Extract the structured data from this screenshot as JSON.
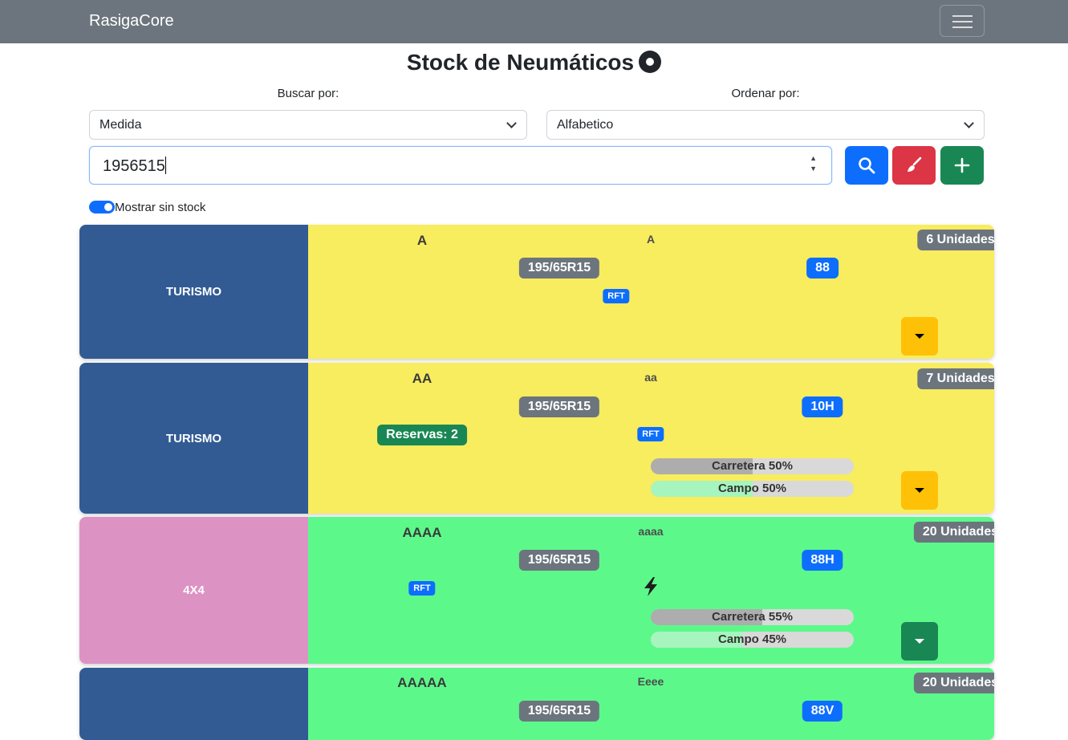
{
  "navbar": {
    "brand": "RasigaCore"
  },
  "page": {
    "title": "Stock de Neumáticos"
  },
  "filters": {
    "search_by_label": "Buscar por:",
    "search_by_value": "Medida",
    "order_by_label": "Ordenar por:",
    "order_by_value": "Alfabetico",
    "query_value": "1956515",
    "show_no_stock_label": "Mostrar sin stock",
    "show_no_stock": true
  },
  "colors": {
    "navbar": "#6c757d",
    "search_button": "#0d6efd",
    "clear_button": "#dc3545",
    "add_button": "#198754",
    "yellow_card": "#f8ec5f",
    "green_card": "#5cf98a",
    "turismo": "#325b94",
    "4x4": "#dd92c4"
  },
  "cards": [
    {
      "category": "TURISMO",
      "brand": "A",
      "model": "A",
      "units": "6 Unidades",
      "size": "195/65R15",
      "load": "88",
      "rft": "RFT"
    },
    {
      "category": "TURISMO",
      "brand": "AA",
      "model": "aa",
      "units": "7 Unidades",
      "size": "195/65R15",
      "load": "10H",
      "reservations": "Reservas: 2",
      "rft": "RFT",
      "road": {
        "label": "Carretera 50%",
        "percent": 50
      },
      "field": {
        "label": "Campo 50%",
        "percent": 50
      }
    },
    {
      "category": "4X4",
      "brand": "AAAA",
      "model": "aaaa",
      "units": "20 Unidades",
      "size": "195/65R15",
      "load": "88H",
      "rft": "RFT",
      "icon": "lightning-icon",
      "road": {
        "label": "Carretera 55%",
        "percent": 55
      },
      "field": {
        "label": "Campo 45%",
        "percent": 45
      }
    },
    {
      "category": "",
      "brand": "AAAAA",
      "model": "Eeee",
      "units": "20 Unidades",
      "size": "195/65R15",
      "load": "88V"
    }
  ]
}
